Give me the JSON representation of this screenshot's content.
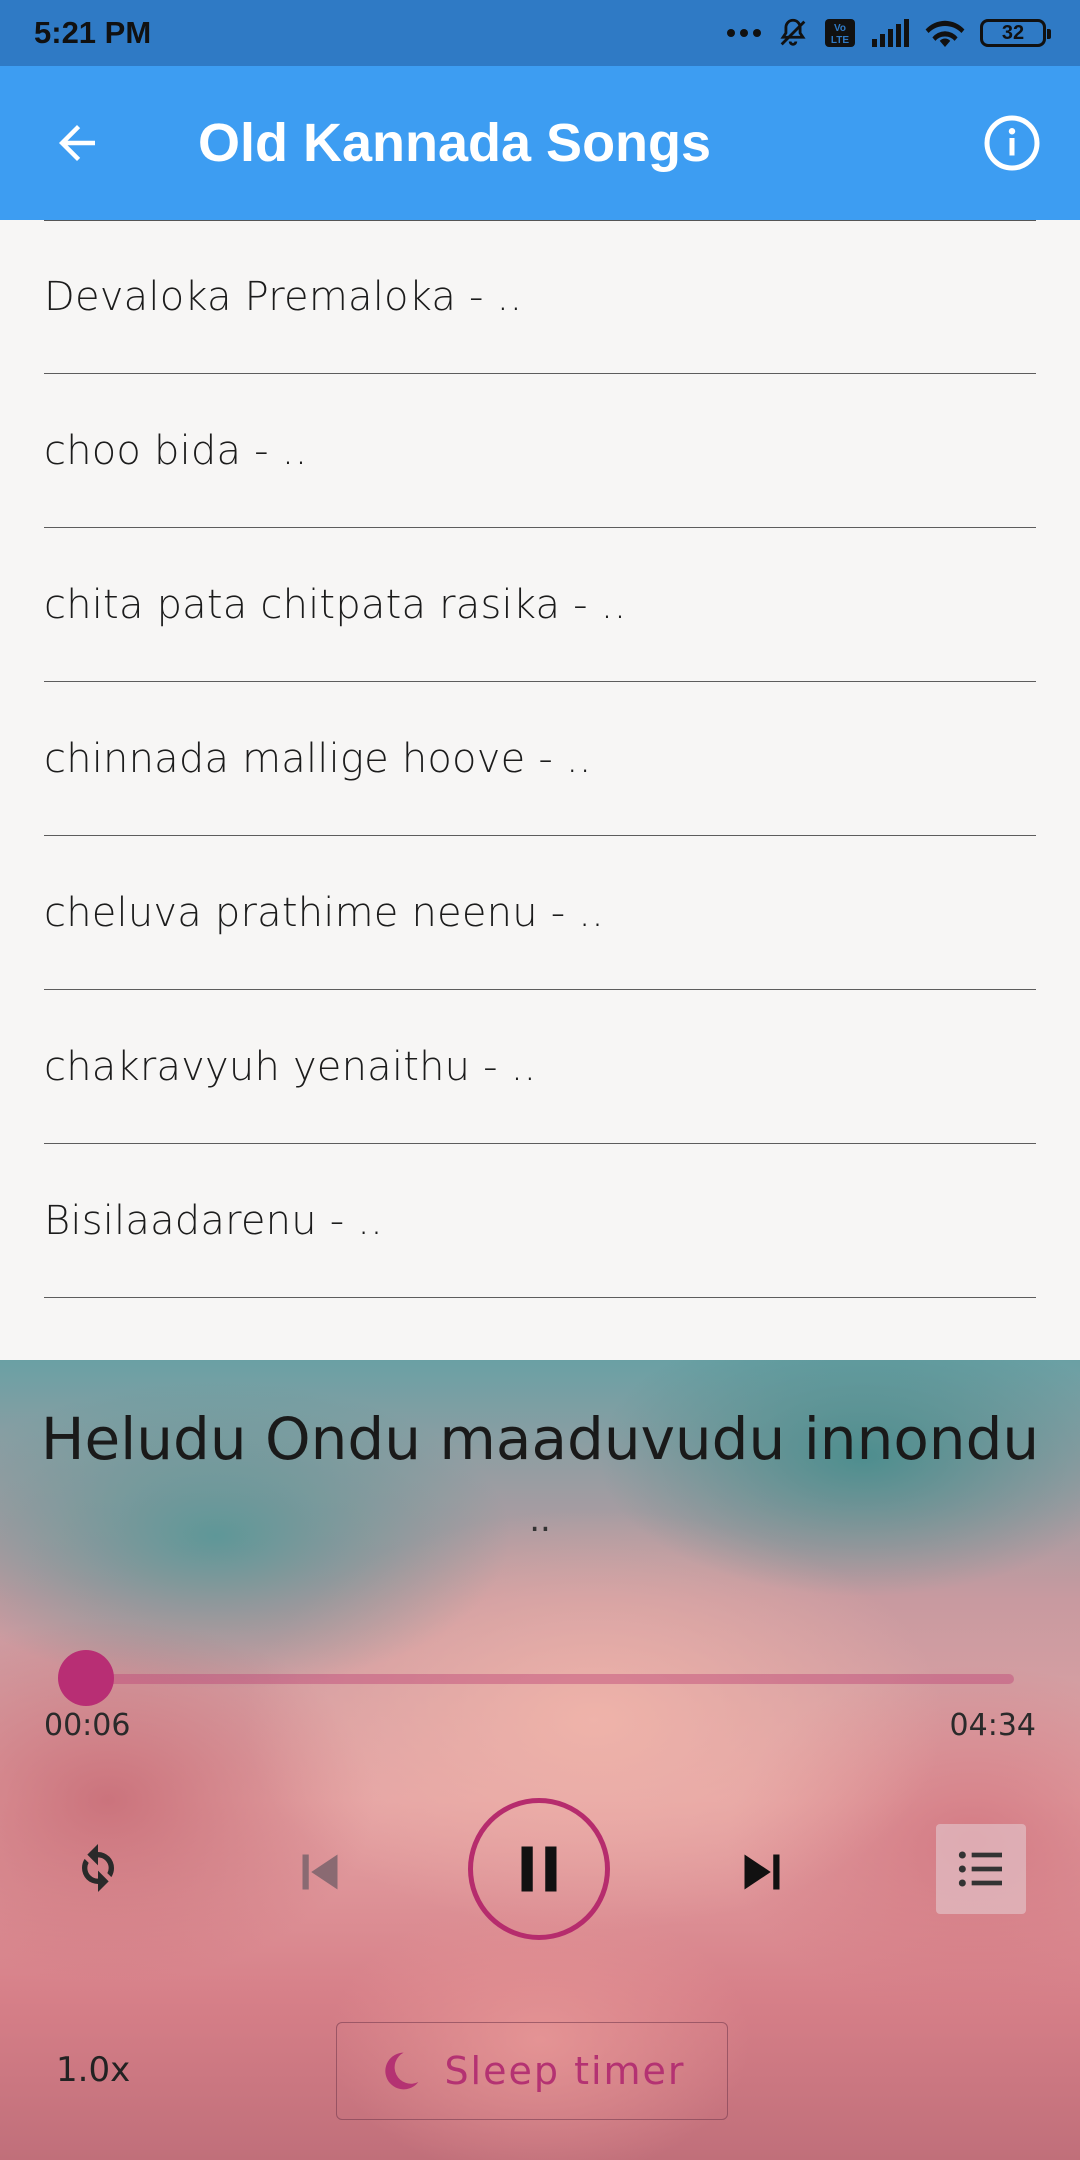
{
  "status_bar": {
    "time": "5:21 PM",
    "battery": "32"
  },
  "app_bar": {
    "title": "Old Kannada Songs",
    "back_icon": "arrow-left-icon",
    "info_icon": "info-icon"
  },
  "songs": [
    "Devaloka Premaloka - ..",
    "choo bida - ..",
    "chita pata chitpata rasika - ..",
    "chinnada mallige hoove - ..",
    "cheluva prathime neenu - ..",
    "chakravyuh yenaithu - ..",
    "Bisilaadarenu - .."
  ],
  "player": {
    "title": "Heludu Ondu maaduvudu innondu",
    "subtitle": "..",
    "elapsed": "00:06",
    "total": "04:34",
    "progress_fraction": 0.02,
    "speed": "1.0x",
    "sleep_timer_label": "Sleep timer",
    "accent_color": "#b82e74"
  }
}
